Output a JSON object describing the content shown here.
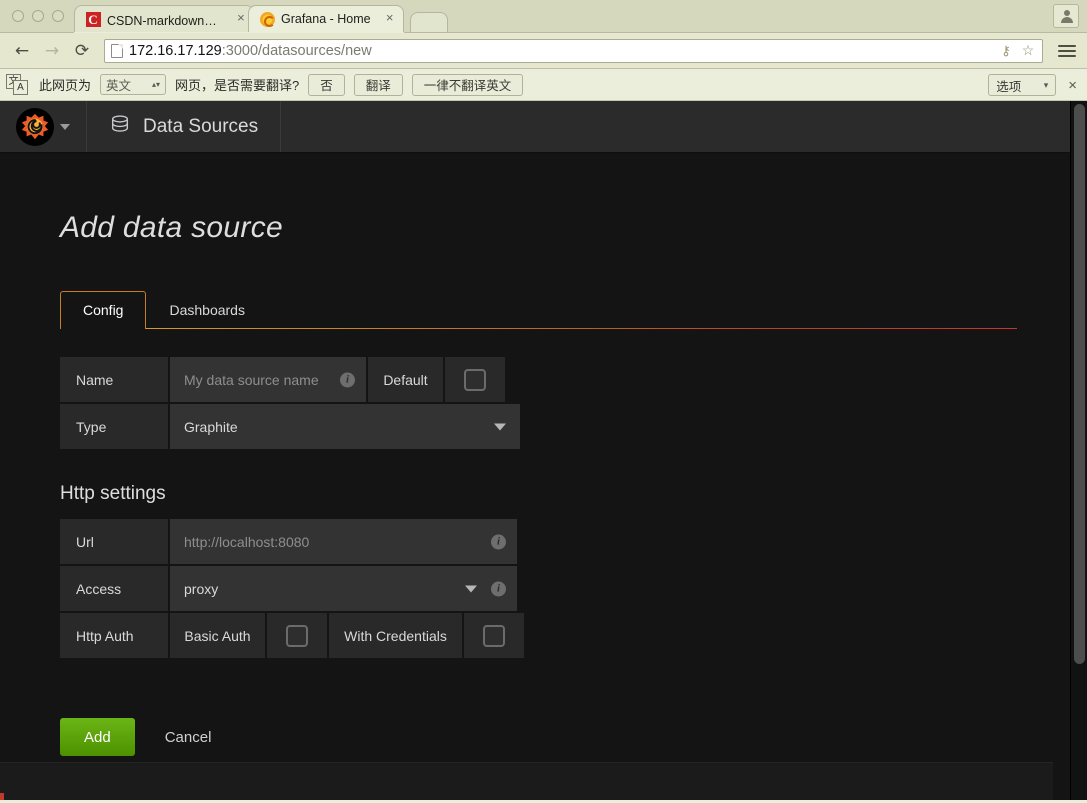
{
  "browser": {
    "window_buttons": [
      "close",
      "minimize",
      "maximize"
    ],
    "tabs": [
      {
        "title": "CSDN-markdown编辑器",
        "favicon": "csdn-icon",
        "active": false,
        "close_label": "×"
      },
      {
        "title": "Grafana - Home",
        "favicon": "grafana-icon",
        "active": true,
        "close_label": "×"
      }
    ],
    "toolbar": {
      "back_label": "←",
      "forward_label": "→",
      "reload_label": "⟳",
      "url_host": "172.16.17.129",
      "url_rest": ":3000/datasources/new",
      "key_icon_label": "⚷",
      "bookmark_star_label": "☆"
    },
    "infobar": {
      "translate_icon_cn": "文",
      "translate_icon_en": "A",
      "prefix_text": "此网页为",
      "language_value": "英文",
      "question_text": "网页，是否需要翻译?",
      "no_button": "否",
      "translate_button": "翻译",
      "never_button": "一律不翻译英文",
      "options_button": "选项",
      "close_label": "×"
    }
  },
  "grafana": {
    "navbar": {
      "brand_label": "grafana-logo",
      "nav_item": "Data Sources"
    },
    "page_title": "Add data source",
    "tabs": [
      {
        "label": "Config",
        "active": true
      },
      {
        "label": "Dashboards",
        "active": false
      }
    ],
    "form": {
      "name_label": "Name",
      "name_placeholder": "My data source name",
      "name_value": "",
      "default_label": "Default",
      "default_checked": false,
      "type_label": "Type",
      "type_value": "Graphite"
    },
    "http_settings": {
      "section_title": "Http settings",
      "url_label": "Url",
      "url_placeholder": "http://localhost:8080",
      "url_value": "",
      "access_label": "Access",
      "access_value": "proxy",
      "http_auth_label": "Http Auth",
      "basic_auth_label": "Basic Auth",
      "basic_auth_checked": false,
      "with_credentials_label": "With Credentials",
      "with_credentials_checked": false
    },
    "actions": {
      "add_label": "Add",
      "cancel_label": "Cancel"
    },
    "colors": {
      "accent_orange": "#c87c25",
      "accent_red": "#c0392b",
      "add_green": "#5ca40a",
      "page_bg": "#141414",
      "navbar_bg": "#2b2b2b",
      "row_bg": "#292929",
      "input_bg": "#333333",
      "text": "#d8d9da"
    }
  }
}
